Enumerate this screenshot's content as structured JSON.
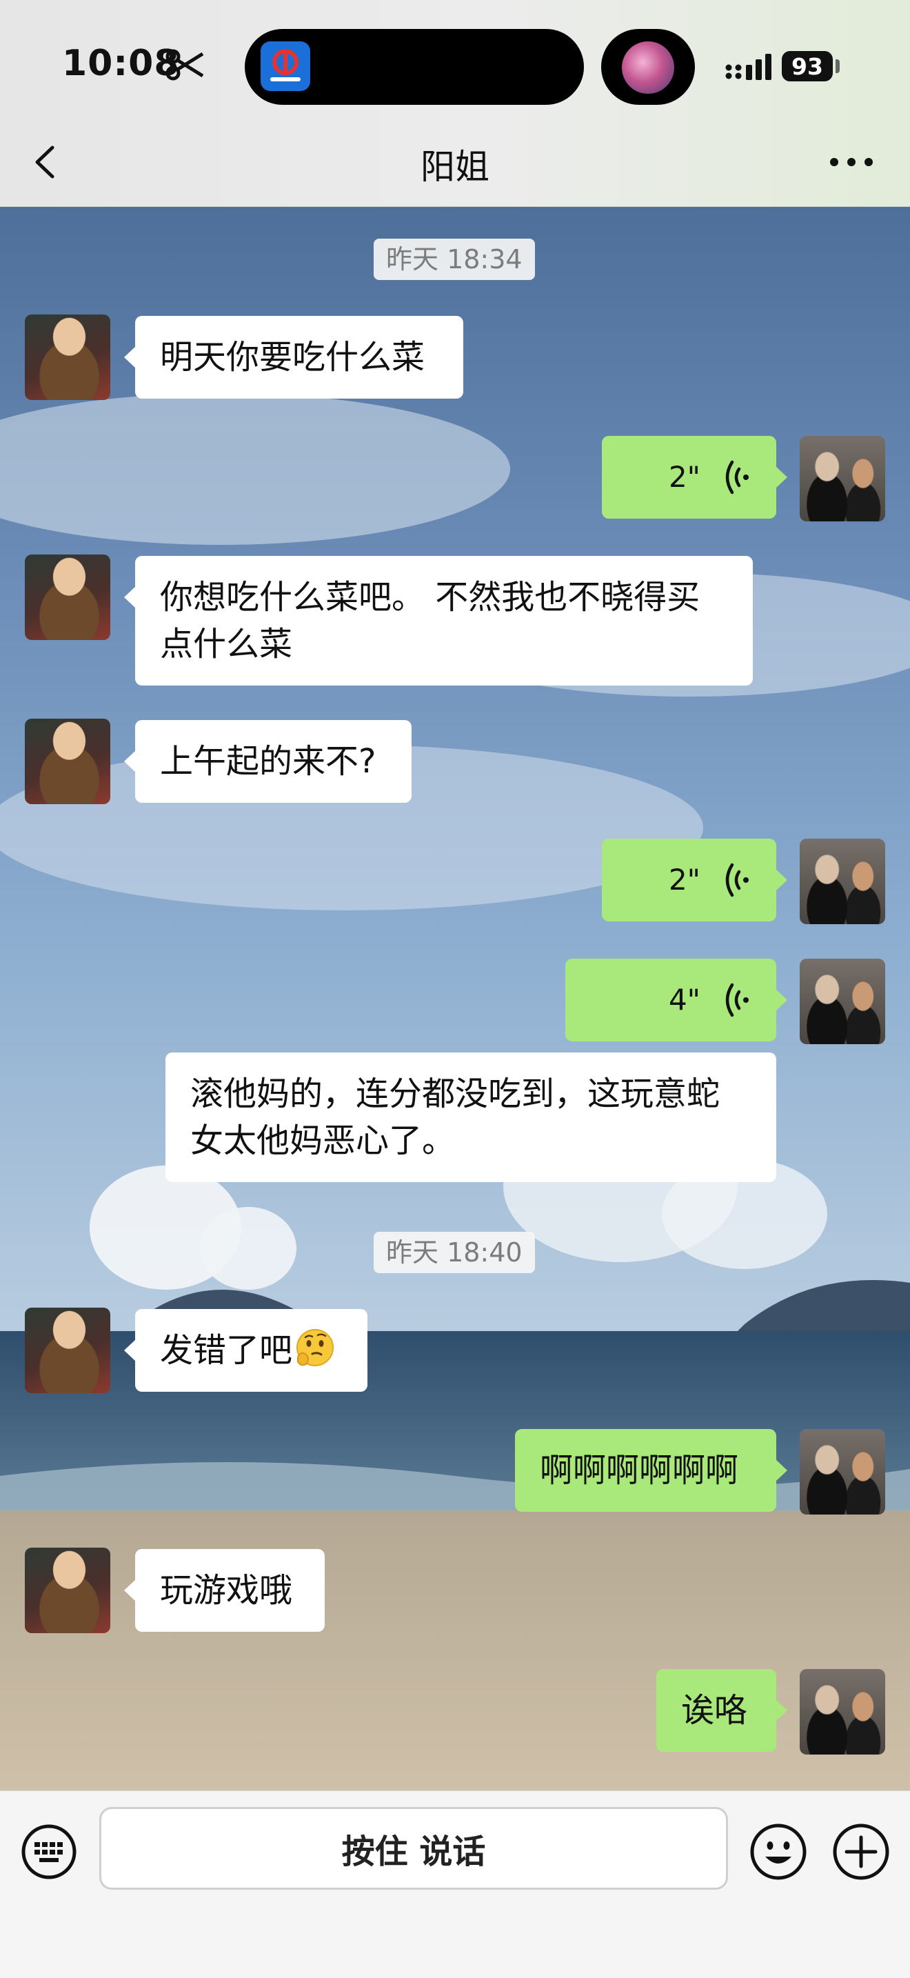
{
  "status_bar": {
    "time": "10:08",
    "battery": "93"
  },
  "header": {
    "title": "阳姐"
  },
  "messages": [
    {
      "type": "timestamp",
      "text": "昨天 18:34"
    },
    {
      "type": "text",
      "from": "friend",
      "text": "明天你要吃什么菜"
    },
    {
      "type": "voice",
      "from": "me",
      "duration": "2\""
    },
    {
      "type": "text",
      "from": "friend",
      "text": "你想吃什么菜吧。 不然我也不晓得买点什么菜"
    },
    {
      "type": "text",
      "from": "friend",
      "text": "上午起的来不?"
    },
    {
      "type": "voice",
      "from": "me",
      "duration": "2\""
    },
    {
      "type": "voice",
      "from": "me",
      "duration": "4\""
    },
    {
      "type": "transcript",
      "from": "me",
      "text": "滚他妈的，连分都没吃到，这玩意蛇女太他妈恶心了。"
    },
    {
      "type": "timestamp",
      "text": "昨天 18:40"
    },
    {
      "type": "text",
      "from": "friend",
      "text": "发错了吧",
      "emoji": "thinking-face-icon"
    },
    {
      "type": "text",
      "from": "me",
      "text": "啊啊啊啊啊啊"
    },
    {
      "type": "text",
      "from": "friend",
      "text": "玩游戏哦"
    },
    {
      "type": "text",
      "from": "me",
      "text": "诶咯"
    }
  ],
  "input_bar": {
    "hold_to_talk_label": "按住 说话"
  },
  "icons": {
    "status": [
      "scissors-icon",
      "railway-app-icon",
      "music-art-icon",
      "signal-icon",
      "battery-icon"
    ],
    "header": [
      "back-icon",
      "more-icon"
    ],
    "input": [
      "keyboard-icon",
      "emoji-icon",
      "plus-icon"
    ]
  },
  "colors": {
    "outgoing_bubble": "#a9e87a",
    "incoming_bubble": "#ffffff"
  }
}
